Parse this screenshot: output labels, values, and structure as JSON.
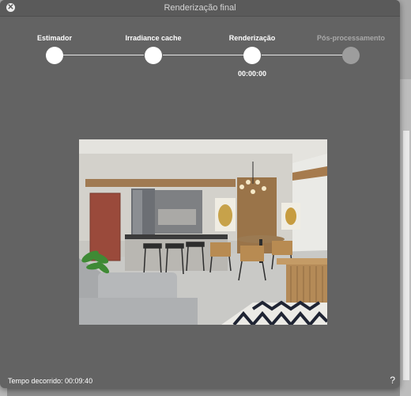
{
  "window": {
    "title": "Renderização final"
  },
  "steps": [
    {
      "label": "Estimador",
      "state": "done"
    },
    {
      "label": "Irradiance cache",
      "state": "done"
    },
    {
      "label": "Renderização",
      "state": "active"
    },
    {
      "label": "Pós-processamento",
      "state": "pending"
    }
  ],
  "render_time": "00:00:00",
  "footer": {
    "elapsed": "Tempo decorrido: 00:09:40",
    "help": "?"
  },
  "colors": {
    "dialog_bg": "#636363",
    "step_active": "#ffffff",
    "step_inactive": "#9d9d9d"
  },
  "icons": {
    "close": "close-icon",
    "help": "help-icon"
  }
}
